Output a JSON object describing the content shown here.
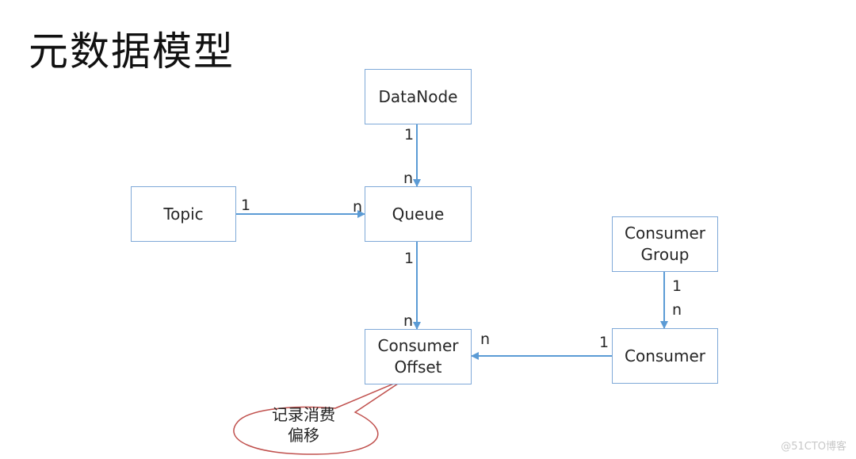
{
  "title": "元数据模型",
  "entities": {
    "datanode": "DataNode",
    "topic": "Topic",
    "queue": "Queue",
    "consumer_offset": "Consumer\nOffset",
    "consumer_group": "Consumer\nGroup",
    "consumer": "Consumer"
  },
  "relations": [
    {
      "from": "DataNode",
      "to": "Queue",
      "from_card": "1",
      "to_card": "n"
    },
    {
      "from": "Topic",
      "to": "Queue",
      "from_card": "1",
      "to_card": "n"
    },
    {
      "from": "Queue",
      "to": "Consumer Offset",
      "from_card": "1",
      "to_card": "n"
    },
    {
      "from": "Consumer Group",
      "to": "Consumer",
      "from_card": "1",
      "to_card": "n"
    },
    {
      "from": "Consumer",
      "to": "Consumer Offset",
      "from_card": "1",
      "to_card": "n"
    }
  ],
  "callout": {
    "text": "记录消费\n偏移",
    "target": "Consumer Offset"
  },
  "colors": {
    "box_border": "#7fa9d8",
    "arrow": "#5b9bd5",
    "callout_border": "#c0504d"
  },
  "watermark": "@51CTO博客"
}
